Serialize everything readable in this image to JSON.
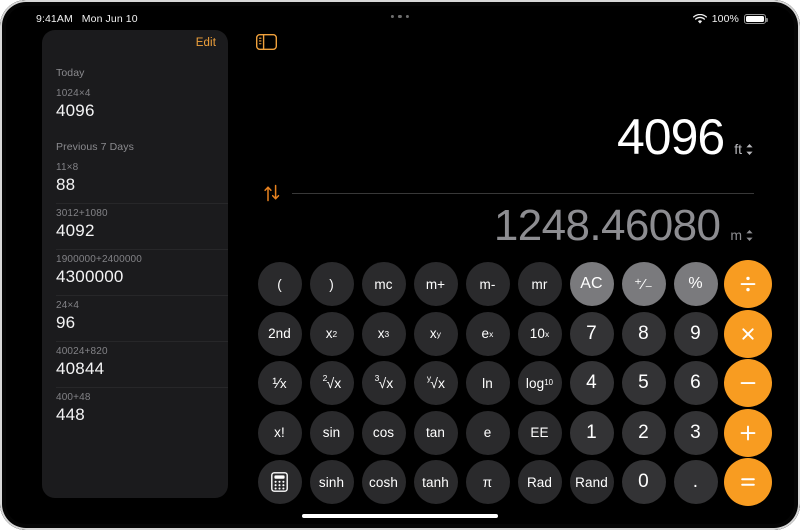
{
  "statusbar": {
    "time": "9:41AM",
    "date": "Mon Jun 10",
    "wifi_icon": "wifi-icon",
    "battery_percent": "100%",
    "battery_icon": "battery-full-icon"
  },
  "multitask_indicator": "three-dots-icon",
  "sidebar": {
    "edit_label": "Edit",
    "toggle_icon": "sidebar-toggle-icon",
    "sections": [
      {
        "title": "Today",
        "items": [
          {
            "expression": "1024×4",
            "result": "4096"
          }
        ]
      },
      {
        "title": "Previous 7 Days",
        "items": [
          {
            "expression": "11×8",
            "result": "88"
          },
          {
            "expression": "3012+1080",
            "result": "4092"
          },
          {
            "expression": "1900000+2400000",
            "result": "4300000"
          },
          {
            "expression": "24×4",
            "result": "96"
          },
          {
            "expression": "40024+820",
            "result": "40844"
          },
          {
            "expression": "400+48",
            "result": "448"
          }
        ]
      }
    ]
  },
  "display": {
    "primary_value": "4096",
    "primary_unit": "ft",
    "secondary_value": "1248.46080",
    "secondary_unit": "m",
    "unit_chevron_icon": "chevron-up-down-icon",
    "swap_icon": "swap-arrows-icon"
  },
  "keypad": {
    "rows": [
      [
        {
          "label": "(",
          "type": "fn",
          "name": "key-open-paren"
        },
        {
          "label": ")",
          "type": "fn",
          "name": "key-close-paren"
        },
        {
          "label": "mc",
          "type": "fn",
          "name": "key-memory-clear"
        },
        {
          "label": "m+",
          "type": "fn",
          "name": "key-memory-add"
        },
        {
          "label": "m-",
          "type": "fn",
          "name": "key-memory-subtract"
        },
        {
          "label": "mr",
          "type": "fn",
          "name": "key-memory-recall"
        },
        {
          "label": "AC",
          "type": "util",
          "name": "key-all-clear"
        },
        {
          "label": "⁺⁄₋",
          "type": "util",
          "name": "key-sign-toggle"
        },
        {
          "label": "%",
          "type": "util",
          "name": "key-percent"
        },
        {
          "label": "÷",
          "type": "op",
          "name": "key-divide"
        }
      ],
      [
        {
          "label": "2nd",
          "type": "fn",
          "name": "key-second-function"
        },
        {
          "label": "x²",
          "type": "fn",
          "name": "key-square"
        },
        {
          "label": "x³",
          "type": "fn",
          "name": "key-cube"
        },
        {
          "label": "xʸ",
          "type": "fn",
          "name": "key-power-y"
        },
        {
          "label": "eˣ",
          "type": "fn",
          "name": "key-e-power-x"
        },
        {
          "label": "10ˣ",
          "type": "fn",
          "name": "key-ten-power-x"
        },
        {
          "label": "7",
          "type": "num",
          "name": "key-7"
        },
        {
          "label": "8",
          "type": "num",
          "name": "key-8"
        },
        {
          "label": "9",
          "type": "num",
          "name": "key-9"
        },
        {
          "label": "×",
          "type": "op",
          "name": "key-multiply"
        }
      ],
      [
        {
          "label": "¹⁄x",
          "type": "fn",
          "name": "key-reciprocal"
        },
        {
          "label": "²√x",
          "type": "fn",
          "name": "key-square-root"
        },
        {
          "label": "³√x",
          "type": "fn",
          "name": "key-cube-root"
        },
        {
          "label": "ʸ√x",
          "type": "fn",
          "name": "key-nth-root"
        },
        {
          "label": "ln",
          "type": "fn",
          "name": "key-natural-log"
        },
        {
          "label": "log₁₀",
          "type": "fn",
          "name": "key-log-base-10"
        },
        {
          "label": "4",
          "type": "num",
          "name": "key-4"
        },
        {
          "label": "5",
          "type": "num",
          "name": "key-5"
        },
        {
          "label": "6",
          "type": "num",
          "name": "key-6"
        },
        {
          "label": "−",
          "type": "op",
          "name": "key-subtract"
        }
      ],
      [
        {
          "label": "x!",
          "type": "fn",
          "name": "key-factorial"
        },
        {
          "label": "sin",
          "type": "fn",
          "name": "key-sin"
        },
        {
          "label": "cos",
          "type": "fn",
          "name": "key-cos"
        },
        {
          "label": "tan",
          "type": "fn",
          "name": "key-tan"
        },
        {
          "label": "e",
          "type": "fn",
          "name": "key-euler"
        },
        {
          "label": "EE",
          "type": "fn",
          "name": "key-exponent-entry"
        },
        {
          "label": "1",
          "type": "num",
          "name": "key-1"
        },
        {
          "label": "2",
          "type": "num",
          "name": "key-2"
        },
        {
          "label": "3",
          "type": "num",
          "name": "key-3"
        },
        {
          "label": "+",
          "type": "op",
          "name": "key-add"
        }
      ],
      [
        {
          "label": "",
          "type": "fn",
          "name": "key-calculator-mode",
          "icon": "calculator-icon"
        },
        {
          "label": "sinh",
          "type": "fn",
          "name": "key-sinh"
        },
        {
          "label": "cosh",
          "type": "fn",
          "name": "key-cosh"
        },
        {
          "label": "tanh",
          "type": "fn",
          "name": "key-tanh"
        },
        {
          "label": "π",
          "type": "fn",
          "name": "key-pi"
        },
        {
          "label": "Rad",
          "type": "fn",
          "name": "key-radians"
        },
        {
          "label": "Rand",
          "type": "fn",
          "name": "key-random"
        },
        {
          "label": "0",
          "type": "num",
          "name": "key-0"
        },
        {
          "label": ".",
          "type": "num",
          "name": "key-decimal"
        },
        {
          "label": "=",
          "type": "op",
          "name": "key-equals"
        }
      ]
    ]
  },
  "colors": {
    "accent_orange": "#f89c21",
    "edit_orange": "#f0a13c",
    "key_dark": "#2a2a2c",
    "key_num": "#333335",
    "key_util": "#7a7a7d",
    "sidebar_bg": "#1b1b1d"
  },
  "home_indicator": "home-indicator"
}
